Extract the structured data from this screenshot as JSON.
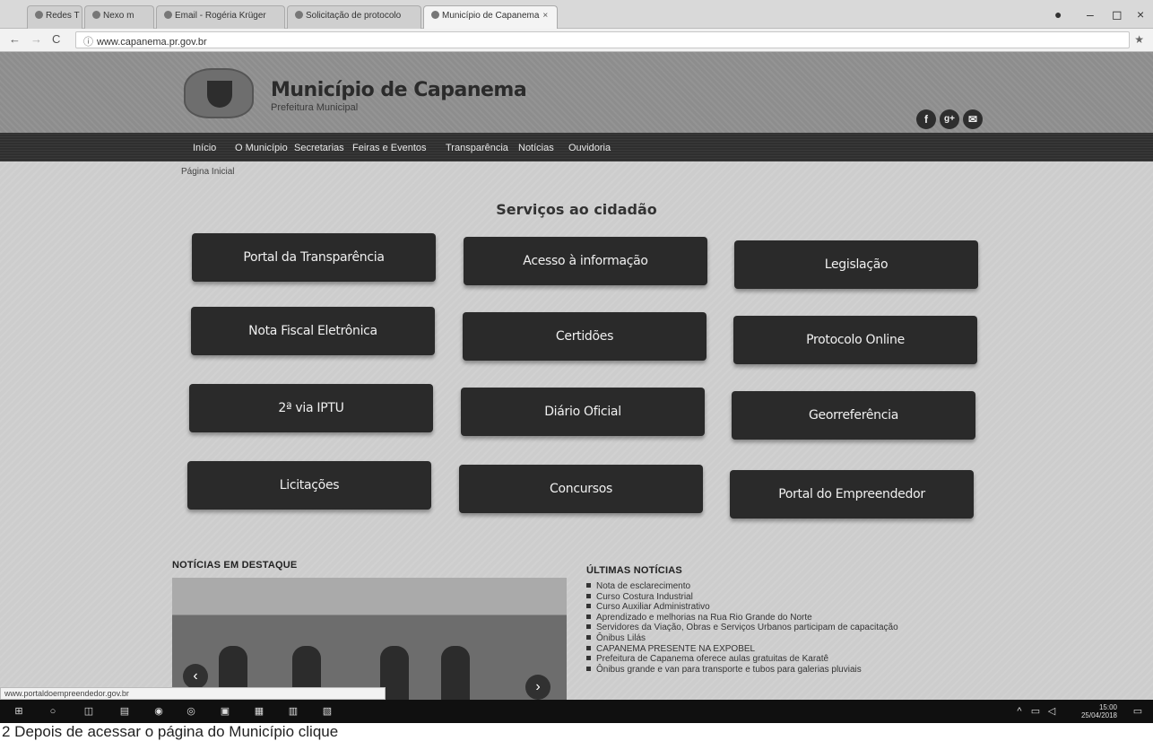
{
  "browser": {
    "tabs": [
      {
        "label": "Redes T"
      },
      {
        "label": "Nexo m"
      },
      {
        "label": "Email - Rogéria Krüger"
      },
      {
        "label": "Solicitação de protocolo"
      },
      {
        "label": "Município de Capanema"
      }
    ],
    "url": "www.capanema.pr.gov.br",
    "window_controls": {
      "minimize": "–",
      "maximize": "◻",
      "close": "×"
    }
  },
  "site": {
    "title": "Município de Capanema",
    "subtitle": "Prefeitura Municipal",
    "social": [
      "f",
      "g+",
      "✉"
    ],
    "nav": [
      "Início",
      "O Município",
      "Secretarias",
      "Feiras e Eventos",
      "Transparência",
      "Notícias",
      "Ouvidoria"
    ],
    "breadcrumb": "Página Inicial"
  },
  "services": {
    "title": "Serviços ao cidadão",
    "items": [
      "Portal da Transparência",
      "Acesso à informação",
      "Legislação",
      "Nota Fiscal Eletrônica",
      "Certidões",
      "Protocolo Online",
      "2ª via IPTU",
      "Diário Oficial",
      "Georreferência",
      "Licitações",
      "Concursos",
      "Portal do Empreendedor"
    ]
  },
  "news": {
    "featured_heading": "NOTÍCIAS EM DESTAQUE",
    "latest_heading": "ÚLTIMAS NOTÍCIAS",
    "latest": [
      "Nota de esclarecimento",
      "Curso Costura Industrial",
      "Curso Auxiliar Administrativo",
      "Aprendizado e melhorias na Rua Rio Grande do Norte",
      "Servidores da Viação, Obras e Serviços Urbanos participam de capacitação",
      "Ônibus Lilás",
      "CAPANEMA PRESENTE NA EXPOBEL",
      "Prefeitura de Capanema oferece aulas gratuitas de Karatê",
      "Ônibus grande e van para transporte e tubos para galerias pluviais"
    ]
  },
  "status_url": "www.portaldoempreendedor.gov.br",
  "taskbar": {
    "time": "15:00",
    "date": "25/04/2018"
  },
  "caption": "2 Depois de acessar o página do Município clique"
}
